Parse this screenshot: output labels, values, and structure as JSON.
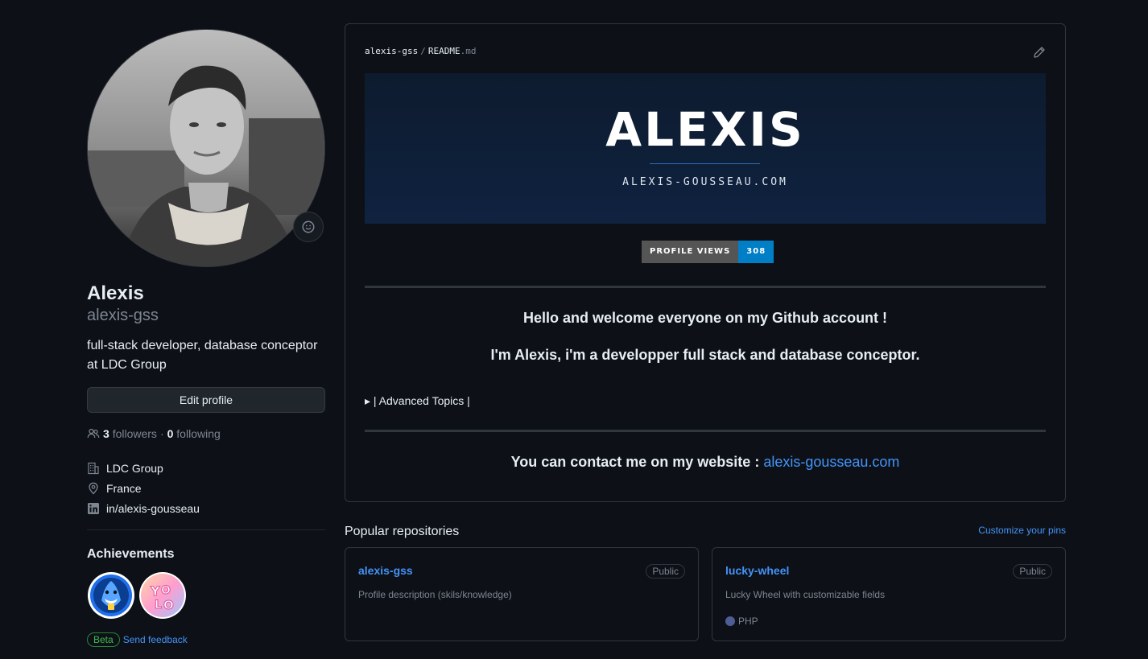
{
  "profile": {
    "name": "Alexis",
    "login": "alexis-gss",
    "bio": "full-stack developer, database conceptor at LDC Group",
    "edit_label": "Edit profile",
    "followers_count": "3",
    "followers_label": "followers",
    "dot": "·",
    "following_count": "0",
    "following_label": "following",
    "company": "LDC Group",
    "location": "France",
    "linkedin": "in/alexis-gousseau",
    "achievements_title": "Achievements",
    "achievements": [
      "shark-badge",
      "yolo-badge"
    ],
    "beta_label": "Beta",
    "feedback_label": "Send feedback"
  },
  "readme": {
    "owner": "alexis-gss",
    "separator": "/",
    "file": "README",
    "ext": ".md",
    "banner_title": "ALEXIS",
    "banner_subtitle": "ALEXIS-GOUSSEAU.COM",
    "views_label": "PROFILE VIEWS",
    "views_value": "308",
    "welcome": "Hello and welcome everyone on my Github account !",
    "intro": "I'm Alexis, i'm a developper full stack and database conceptor.",
    "details_summary": "| Advanced Topics |",
    "contact_text": "You can contact me on my website : ",
    "contact_link": "alexis-gousseau.com"
  },
  "repos": {
    "title": "Popular repositories",
    "customize": "Customize your pins",
    "items": [
      {
        "name": "alexis-gss",
        "visibility": "Public",
        "description": "Profile description (skils/knowledge)",
        "language": ""
      },
      {
        "name": "lucky-wheel",
        "visibility": "Public",
        "description": "Lucky Wheel with customizable fields",
        "language": "PHP",
        "language_color": "#4f5d95"
      }
    ]
  },
  "colors": {
    "background": "#0d1117",
    "link": "#4493f8",
    "border": "#30363d",
    "badge_blue": "#007ec6"
  }
}
